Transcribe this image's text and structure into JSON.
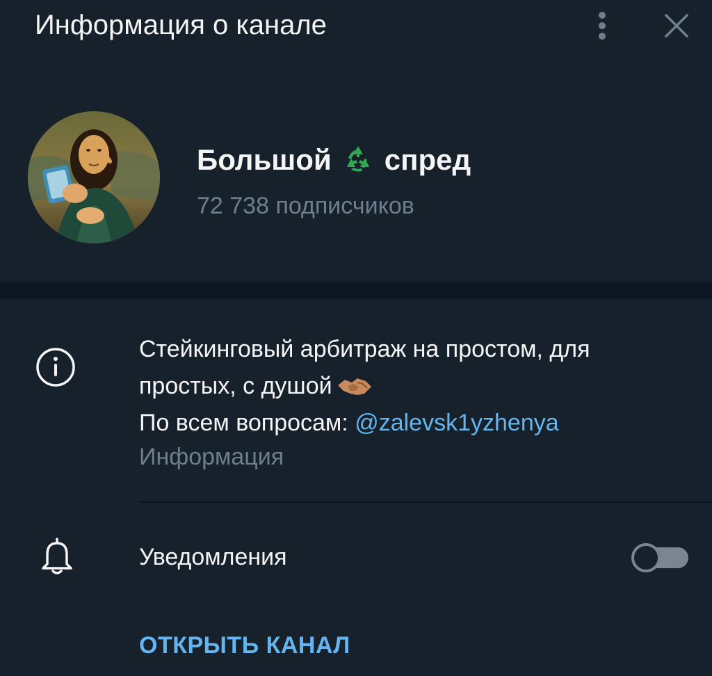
{
  "header": {
    "title": "Информация о канале"
  },
  "channel": {
    "name_part1": "Большой",
    "name_emoji": "recycle-icon",
    "name_part2": "спред",
    "subscribers": "72 738 подписчиков"
  },
  "info": {
    "description_line1": "Стейкинговый арбитраж на простом, для",
    "description_line2": "простых, с душой",
    "description_emoji": "handshake-icon",
    "description_line3_prefix": "По всем вопросам: ",
    "mention": "@zalevsk1yzhenya",
    "label": "Информация"
  },
  "notifications": {
    "label": "Уведомления",
    "enabled": false
  },
  "actions": {
    "open_channel": "ОТКРЫТЬ КАНАЛ"
  },
  "colors": {
    "background": "#17212b",
    "band": "#0e1621",
    "accent": "#64b5ef",
    "muted": "#6d7f8f",
    "text": "#f5f5f5"
  }
}
